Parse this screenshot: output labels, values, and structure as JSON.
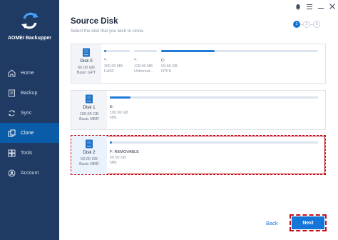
{
  "app": {
    "name": "AOMEI Backupper"
  },
  "sidebar": {
    "items": [
      {
        "label": "Home",
        "icon": "home-icon",
        "active": false
      },
      {
        "label": "Backup",
        "icon": "backup-icon",
        "active": false
      },
      {
        "label": "Sync",
        "icon": "sync-icon",
        "active": false
      },
      {
        "label": "Clone",
        "icon": "clone-icon",
        "active": true
      },
      {
        "label": "Tools",
        "icon": "tools-icon",
        "active": false
      },
      {
        "label": "Account",
        "icon": "account-icon",
        "active": false
      }
    ]
  },
  "header": {
    "title": "Source Disk",
    "subtitle": "Select the disk that you wish to clone.",
    "icons": [
      "bell-icon",
      "menu-icon",
      "minimize-icon",
      "close-icon"
    ]
  },
  "steps": {
    "current": "1",
    "second": "2",
    "third": "3"
  },
  "disks": [
    {
      "name": "Disk 0",
      "size": "60.00 GB",
      "type": "Basic GPT",
      "partitions": [
        {
          "label": "*:",
          "size": "200.00 MB",
          "fs": "Fat32",
          "fill": 0.08
        },
        {
          "label": "*:",
          "size": "128.00 MB",
          "fs": "Unformat...",
          "fill": 0.0
        },
        {
          "label": "C:",
          "size": "59.68 GB",
          "fs": "NTFS",
          "fill": 0.34
        }
      ]
    },
    {
      "name": "Disk 1",
      "size": "100.00 GB",
      "type": "Basic MBR",
      "partitions": [
        {
          "label": "E:",
          "size": "100.00 GB",
          "fs": "Ntfs",
          "fill": 0.1
        }
      ]
    },
    {
      "name": "Disk 2",
      "size": "50.00 GB",
      "type": "Basic MBR",
      "partitions": [
        {
          "label": "F: REMOVABLE",
          "size": "50.00 GB",
          "fs": "Ntfs",
          "fill": 0.01
        }
      ]
    }
  ],
  "footer": {
    "back_label": "Back",
    "next_label": "Next"
  },
  "colors": {
    "sidebar": "#1f3a63",
    "accent": "#1476d8",
    "highlight": "#c4101c"
  }
}
